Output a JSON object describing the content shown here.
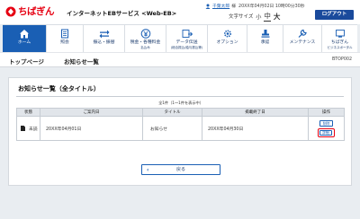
{
  "header": {
    "logo_text": "ちばぎん",
    "service_title": "インターネットEBサービス <Web-EB>",
    "user_name": "千葉太郎",
    "user_suffix": "様",
    "last_login": "20XX年04月02日 10時00分30秒",
    "font_size_label": "文字サイズ",
    "font_small": "小",
    "font_mid": "中",
    "font_large": "大",
    "logout_label": "ログアウト"
  },
  "menu": {
    "items": [
      {
        "label": "ホーム",
        "sub": ""
      },
      {
        "label": "照会",
        "sub": ""
      },
      {
        "label": "振込・振替",
        "sub": ""
      },
      {
        "label": "税金・各種料金",
        "sub": "払込み"
      },
      {
        "label": "データ伝送",
        "sub": "(総合振込/給与振込等)"
      },
      {
        "label": "オプション",
        "sub": ""
      },
      {
        "label": "承認",
        "sub": ""
      },
      {
        "label": "メンテナンス",
        "sub": ""
      },
      {
        "label": "ちばぎん",
        "sub": "ビジネスポータル"
      }
    ]
  },
  "breadcrumb": {
    "top": "トップページ",
    "current": "お知らせ一覧",
    "screen_id": "BTOP002"
  },
  "panel": {
    "title": "お知らせ一覧（全タイトル）",
    "count_text": "全1件（1～1件を表示中）",
    "columns": [
      "状態",
      "ご案内日",
      "タイトル",
      "掲載終了日",
      "操作"
    ],
    "rows": [
      {
        "status": "未読",
        "date": "20XX年04月01日",
        "title": "お知らせ",
        "end_date": "20XX年04月30日",
        "delete_label": "削除",
        "detail_label": "詳細"
      }
    ],
    "back_label": "戻る"
  },
  "colors": {
    "brand_red": "#e60012",
    "primary_blue": "#1a5fb4",
    "dark_blue": "#1a4a9c"
  }
}
